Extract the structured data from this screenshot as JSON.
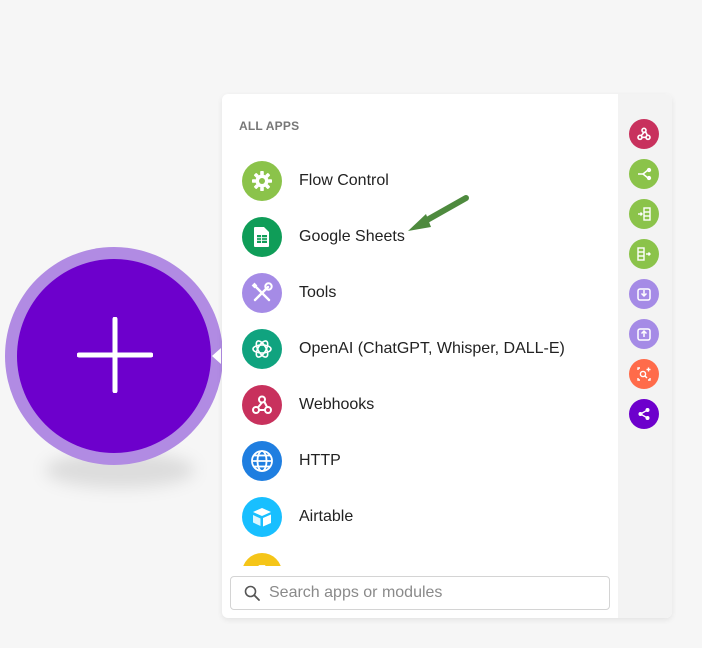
{
  "panel": {
    "title": "ALL APPS",
    "apps": [
      {
        "label": "Flow Control",
        "icon": "gear-icon",
        "color": "#8bc34a"
      },
      {
        "label": "Google Sheets",
        "icon": "spreadsheet-icon",
        "color": "#0f9d58"
      },
      {
        "label": "Tools",
        "icon": "wrench-screwdriver-icon",
        "color": "#a58be6"
      },
      {
        "label": "OpenAI (ChatGPT, Whisper, DALL-E)",
        "icon": "openai-icon",
        "color": "#10a37f"
      },
      {
        "label": "Webhooks",
        "icon": "webhook-icon",
        "color": "#c8315d"
      },
      {
        "label": "HTTP",
        "icon": "globe-icon",
        "color": "#1f7ee0"
      },
      {
        "label": "Airtable",
        "icon": "airtable-icon",
        "color": "#18bfff"
      },
      {
        "label": "",
        "icon": "google-drive-icon",
        "color": "#f5c518"
      }
    ],
    "search": {
      "placeholder": "Search apps or modules",
      "value": ""
    }
  },
  "sidebar": {
    "buttons": [
      {
        "name": "webhooks",
        "icon": "webhook-icon",
        "color": "#c8315d"
      },
      {
        "name": "router",
        "icon": "router-icon",
        "color": "#8bc34a"
      },
      {
        "name": "iterator",
        "icon": "iterator-icon",
        "color": "#8bc34a"
      },
      {
        "name": "aggregator",
        "icon": "aggregator-icon",
        "color": "#8bc34a"
      },
      {
        "name": "import",
        "icon": "import-icon",
        "color": "#a58be6"
      },
      {
        "name": "export",
        "icon": "export-icon",
        "color": "#a58be6"
      },
      {
        "name": "search",
        "icon": "search-plus-icon",
        "color": "#ff6b4a"
      },
      {
        "name": "share",
        "icon": "share-icon",
        "color": "#6d00cc"
      }
    ]
  },
  "accent": {
    "add_button": "#6d00cc",
    "add_ring": "#b18be3",
    "annotation_arrow": "#4e8a3e"
  }
}
